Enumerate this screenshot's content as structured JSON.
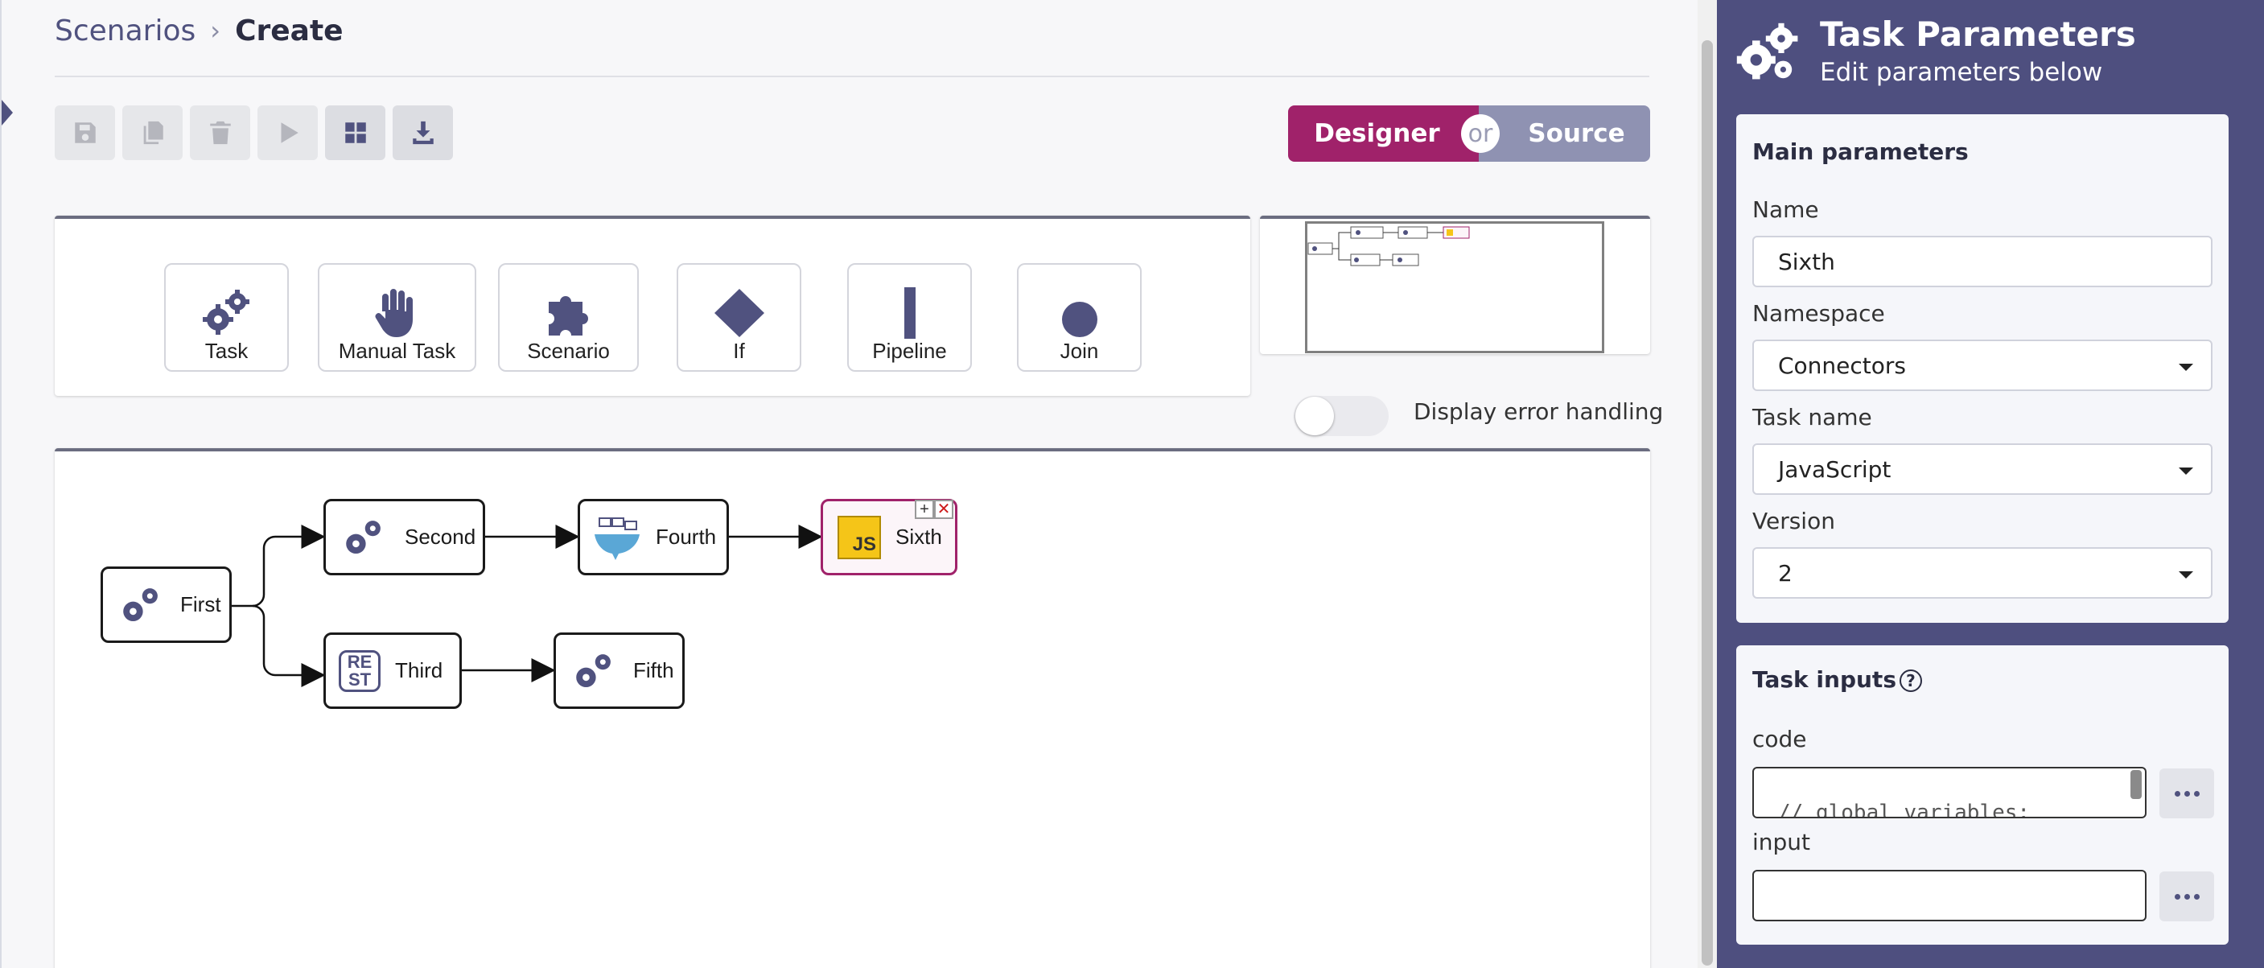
{
  "breadcrumb": {
    "parent": "Scenarios",
    "separator": "›",
    "current": "Create"
  },
  "toolbar": {
    "buttons": [
      {
        "name": "save-button",
        "icon": "save-icon",
        "enabled": false
      },
      {
        "name": "copy-button",
        "icon": "copy-icon",
        "enabled": false
      },
      {
        "name": "delete-button",
        "icon": "trash-icon",
        "enabled": false
      },
      {
        "name": "run-button",
        "icon": "play-icon",
        "enabled": false
      },
      {
        "name": "layout-button",
        "icon": "grid-icon",
        "enabled": true
      },
      {
        "name": "download-button",
        "icon": "download-icon",
        "enabled": true
      }
    ]
  },
  "mode": {
    "designer": "Designer",
    "or": "or",
    "source": "Source",
    "active": "Designer"
  },
  "palette": {
    "items": [
      {
        "label": "Task",
        "icon": "gears-icon"
      },
      {
        "label": "Manual Task",
        "icon": "hand-icon"
      },
      {
        "label": "Scenario",
        "icon": "puzzle-icon"
      },
      {
        "label": "If",
        "icon": "diamond-icon"
      },
      {
        "label": "Pipeline",
        "icon": "bar-icon"
      },
      {
        "label": "Join",
        "icon": "circle-icon"
      }
    ]
  },
  "error_handling": {
    "label": "Display error handling",
    "enabled": false
  },
  "canvas": {
    "nodes": [
      {
        "id": "first",
        "label": "First",
        "icon": "gears-icon"
      },
      {
        "id": "second",
        "label": "Second",
        "icon": "gears-icon"
      },
      {
        "id": "third",
        "label": "Third",
        "icon": "rest-icon"
      },
      {
        "id": "fourth",
        "label": "Fourth",
        "icon": "docker-icon"
      },
      {
        "id": "fifth",
        "label": "Fifth",
        "icon": "gears-icon"
      },
      {
        "id": "sixth",
        "label": "Sixth",
        "icon": "js-icon",
        "selected": true,
        "add": "+",
        "remove": "✕"
      }
    ],
    "js_badge": "JS",
    "rest_badge_top": "RE",
    "rest_badge_bottom": "ST"
  },
  "sidebar": {
    "title": "Task Parameters",
    "subtitle": "Edit parameters below",
    "main": {
      "title": "Main parameters",
      "name_label": "Name",
      "name_value": "Sixth",
      "namespace_label": "Namespace",
      "namespace_value": "Connectors",
      "task_name_label": "Task name",
      "task_name_value": "JavaScript",
      "version_label": "Version",
      "version_value": "2"
    },
    "inputs": {
      "title": "Task inputs",
      "help": "?",
      "code_label": "code",
      "code_value": "// global variables:",
      "input_label": "input",
      "input_value": ""
    }
  },
  "colors": {
    "accent": "#a0226a",
    "sidebar": "#4e4f7f",
    "icon": "#50527f",
    "source_toggle": "#8f92b2"
  }
}
